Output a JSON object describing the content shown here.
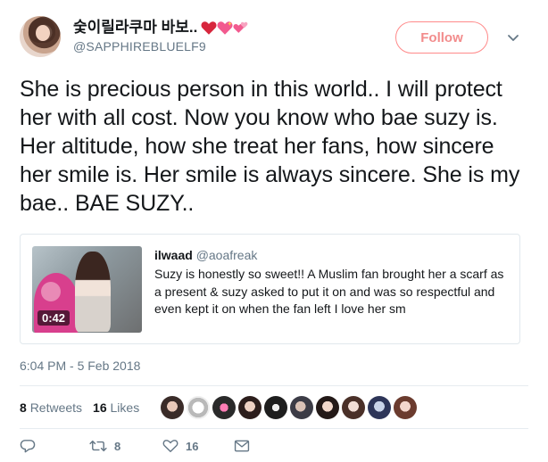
{
  "author": {
    "display_name": "숯이릴라쿠마 바보..",
    "handle": "@SAPPHIREBLUELF9",
    "emoji": [
      "red-heart",
      "sparkling-heart",
      "two-hearts"
    ]
  },
  "header": {
    "follow_label": "Follow"
  },
  "tweet": {
    "text": "She is precious person in this world.. I will protect her with all cost. Now you know who bae suzy is. Her altitude, how she treat her fans, how  sincere her smile is. Her smile is always sincere. She is my bae.. BAE SUZY..",
    "timestamp": "6:04 PM - 5 Feb 2018"
  },
  "quote": {
    "name": "ilwaad",
    "handle": "@aoafreak",
    "text": "Suzy is honestly so sweet!! A Muslim fan brought her a scarf as a present & suzy asked to put it on and was so respectful and even kept it on when the fan left I love her sm",
    "video_duration": "0:42"
  },
  "stats": {
    "retweets_count": "8",
    "retweets_label": "Retweets",
    "likes_count": "16",
    "likes_label": "Likes"
  },
  "actions": {
    "retweet_count": "8",
    "like_count": "16"
  },
  "colors": {
    "follow_accent": "#f28c8c",
    "text_primary": "#14171a",
    "text_secondary": "#657786",
    "border": "#e1e8ed"
  }
}
